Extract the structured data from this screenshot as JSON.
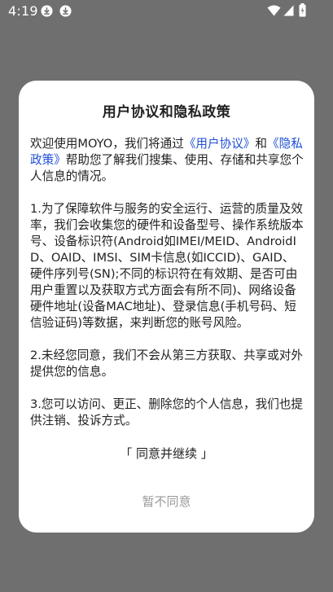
{
  "status_bar": {
    "time": "4:19",
    "icons": [
      "download-icon",
      "download-icon",
      "wifi-icon",
      "signal-icon",
      "battery-icon"
    ]
  },
  "dialog": {
    "title": "用户协议和隐私政策",
    "intro": {
      "prefix": "欢迎使用MOYO，我们将通过",
      "link_user_agreement": "《用户协议》",
      "and": "和",
      "link_privacy_policy": "《隐私政策》",
      "suffix": "帮助您了解我们搜集、使用、存储和共享您个人信息的情况。"
    },
    "paragraphs": [
      "1.为了保障软件与服务的安全运行、运营的质量及效率，我们会收集您的硬件和设备型号、操作系统版本号、设备标识符(Android如IMEI/MEID、AndroidID、OAID、IMSI、SIM卡信息(如ICCID)、GAID、硬件序列号(SN);不同的标识符在有效期、是否可由用户重置以及获取方式方面会有所不同)、网络设备硬件地址(设备MAC地址)、登录信息(手机号码、短信验证码)等数据，来判断您的账号风险。",
      "2.未经您同意，我们不会从第三方获取、共享或对外提供您的信息。",
      "3.您可以访问、更正、删除您的个人信息，我们也提供注销、投诉方式。"
    ],
    "agree_label": "「 同意并继续 」",
    "disagree_label": "暂不同意"
  },
  "colors": {
    "backdrop": "#6f6f6f",
    "link": "#1f4fd6",
    "disagree_text": "#9a9a9a"
  }
}
